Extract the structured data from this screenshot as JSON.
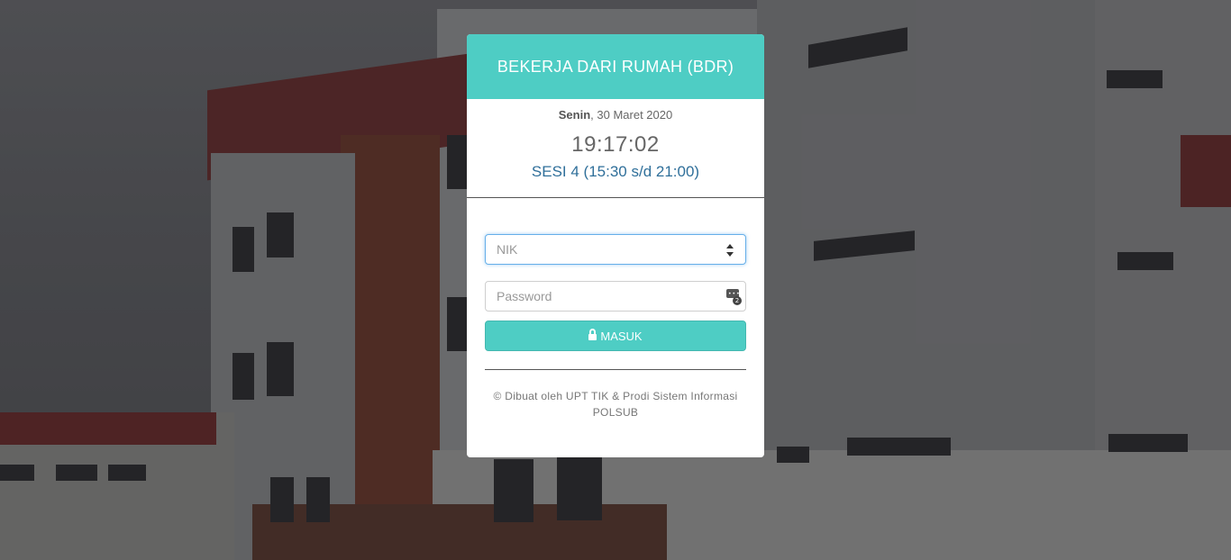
{
  "header": {
    "title": "BEKERJA DARI RUMAH (BDR)"
  },
  "datetime": {
    "day": "Senin",
    "date": ", 30 Maret 2020",
    "time": "19:17:02",
    "session": "SESI 4 (15:30 s/d 21:00)"
  },
  "form": {
    "nik_placeholder": "NIK",
    "password_placeholder": "Password",
    "login_label": "MASUK"
  },
  "footer": {
    "credit": "© Dibuat oleh UPT TIK & Prodi Sistem Informasi POLSUB"
  },
  "colors": {
    "accent": "#4ecdc4",
    "session_text": "#2f6f9a"
  },
  "icons": {
    "login": "lock-icon",
    "nik_field": "spinner-icon",
    "password_field": "keypad-icon"
  }
}
